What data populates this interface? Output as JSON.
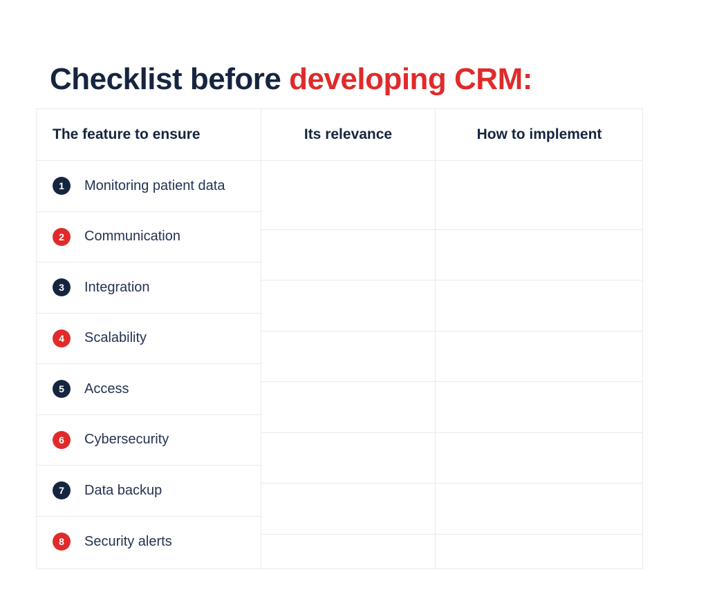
{
  "title": {
    "text_dark": "Checklist before ",
    "text_accent": "developing CRM:"
  },
  "colors": {
    "navy": "#16253f",
    "red": "#e02b2b",
    "title_red": "#df2b2b",
    "label_navy": "#233253",
    "border": "#e9eaee",
    "background": "#ffffff"
  },
  "table": {
    "columns": [
      {
        "header": "The feature to ensure"
      },
      {
        "header": "Its relevance"
      },
      {
        "header": "How to implement"
      }
    ],
    "rows": [
      {
        "number": "1",
        "badge_color": "navy",
        "feature": "Monitoring patient data",
        "relevance": "",
        "implementation": ""
      },
      {
        "number": "2",
        "badge_color": "red",
        "feature": "Communication",
        "relevance": "",
        "implementation": ""
      },
      {
        "number": "3",
        "badge_color": "navy",
        "feature": "Integration",
        "relevance": "",
        "implementation": ""
      },
      {
        "number": "4",
        "badge_color": "red",
        "feature": "Scalability",
        "relevance": "",
        "implementation": ""
      },
      {
        "number": "5",
        "badge_color": "navy",
        "feature": "Access",
        "relevance": "",
        "implementation": ""
      },
      {
        "number": "6",
        "badge_color": "red",
        "feature": "Cybersecurity",
        "relevance": "",
        "implementation": ""
      },
      {
        "number": "7",
        "badge_color": "navy",
        "feature": "Data backup",
        "relevance": "",
        "implementation": ""
      },
      {
        "number": "8",
        "badge_color": "red",
        "feature": "Security alerts",
        "relevance": "",
        "implementation": ""
      }
    ]
  }
}
